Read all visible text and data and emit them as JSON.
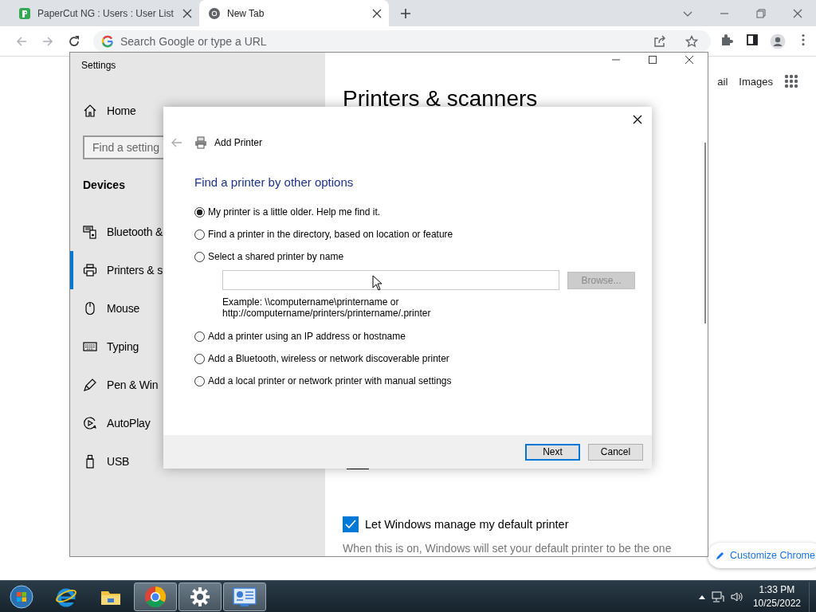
{
  "browser": {
    "tabs": [
      {
        "title": "PaperCut NG : Users : User List",
        "kind": "papercut",
        "selected": false
      },
      {
        "title": "New Tab",
        "kind": "chrome",
        "selected": true
      }
    ],
    "omnibox": {
      "placeholder": "Search Google or type a URL"
    },
    "page": {
      "header_links": [
        "ail",
        "Images"
      ],
      "customize_button": "Customize Chrome"
    }
  },
  "settings_window": {
    "title": "Settings",
    "home": "Home",
    "search": {
      "placeholder": "Find a setting"
    },
    "section": "Devices",
    "nav_items": [
      {
        "label": "Bluetooth &",
        "kind": "devices",
        "selected": false
      },
      {
        "label": "Printers & s",
        "kind": "printer",
        "selected": true
      },
      {
        "label": "Mouse",
        "kind": "mouse",
        "selected": false
      },
      {
        "label": "Typing",
        "kind": "keyboard",
        "selected": false
      },
      {
        "label": "Pen & Win",
        "kind": "pen",
        "selected": false
      },
      {
        "label": "AutoPlay",
        "kind": "autoplay",
        "selected": false
      },
      {
        "label": "USB",
        "kind": "usb",
        "selected": false
      }
    ],
    "heading": "Printers & scanners",
    "default_printer": {
      "label": "Let Windows manage my default printer",
      "checked": true
    },
    "description": "When this is on, Windows will set your default printer to be the one"
  },
  "dialog": {
    "title": "Add Printer",
    "heading": "Find a printer by other options",
    "options": [
      {
        "label": "My printer is a little older. Help me find it.",
        "kind": "plain",
        "selected": true
      },
      {
        "label": "Find a printer in the directory, based on location or feature",
        "kind": "plain",
        "selected": false
      },
      {
        "label": "Select a shared printer by name",
        "kind": "name_field",
        "selected": false,
        "browse_button": {
          "label": "Browse...",
          "disabled": true
        },
        "example": "Example: \\\\computername\\printername or\nhttp://computername/printers/printername/.printer"
      },
      {
        "label": "Add a printer using an IP address or hostname",
        "kind": "plain",
        "selected": false
      },
      {
        "label": "Add a Bluetooth, wireless or network discoverable printer",
        "kind": "plain",
        "selected": false
      },
      {
        "label": "Add a local printer or network printer with manual settings",
        "kind": "plain",
        "selected": false
      }
    ],
    "buttons": [
      {
        "label": "Next",
        "default": true
      },
      {
        "label": "Cancel",
        "default": false
      }
    ]
  },
  "taskbar": {
    "apps": [
      {
        "kind": "start",
        "active": false
      },
      {
        "kind": "ie",
        "active": false
      },
      {
        "kind": "explorer",
        "active": false
      },
      {
        "kind": "chrome",
        "active": true
      },
      {
        "kind": "settings",
        "active": true
      },
      {
        "kind": "control_panel",
        "active": true
      }
    ],
    "clock": {
      "time": "1:33 PM",
      "date": "10/25/2022"
    }
  }
}
